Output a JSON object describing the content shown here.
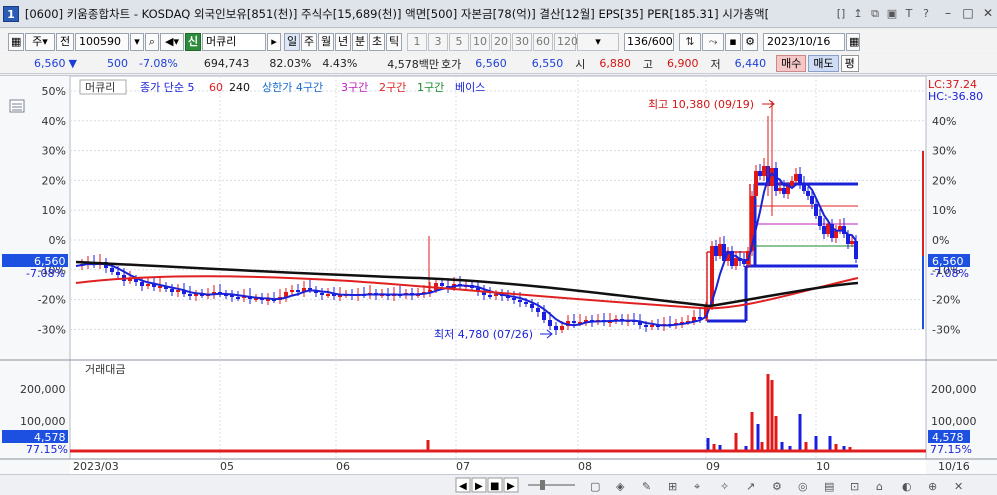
{
  "window": {
    "app_icon": "1",
    "title": "[0600] 키움종합차트 - KOSDAQ 외국인보유[851(천)] 주식수[15,689(천)] 액면[500] 자본금[78(억)] 결산[12월] EPS[35] PER[185.31] 시가총액[",
    "title_tools": [
      "[]",
      "↥",
      "⧉",
      "▣",
      "T",
      "?"
    ],
    "controls": [
      "–",
      "□",
      "✕"
    ]
  },
  "toolbar": {
    "market_select": "주",
    "prev_label": "전",
    "code": "100590",
    "stock_tag": "신",
    "stock_name": "머큐리",
    "period_buttons": [
      "일",
      "주",
      "월",
      "년",
      "분",
      "초",
      "틱"
    ],
    "interval_buttons": [
      "1",
      "3",
      "5",
      "10",
      "20",
      "30",
      "60",
      "120"
    ],
    "count": "136/600",
    "date": "2023/10/16"
  },
  "info": {
    "price": "6,560",
    "change_arrow": "▼",
    "change": "500",
    "change_pct": "-7.08%",
    "volume": "694,743",
    "vol_ratio": "82.03%",
    "turnover": "4.43%",
    "amount": "4,578백만",
    "quote_label": "호가",
    "ask": "6,560",
    "bid": "6,550",
    "open_label": "시",
    "open": "6,880",
    "high_label": "고",
    "high": "6,900",
    "low_label": "저",
    "low": "6,440",
    "buy_btn": "매수",
    "sell_btn": "매도",
    "eval_btn": "평"
  },
  "legend": {
    "name": "머큐리",
    "ma_label": "종가 단순 5",
    "ma60": "60",
    "ma240": "240",
    "sec4": "상한가 4구간",
    "sec3": "3구간",
    "sec2": "2구간",
    "sec1": "1구간",
    "base": "베이스"
  },
  "annotations": {
    "high": "최고 10,380 (09/19)",
    "low": "최저 4,780 (07/26)"
  },
  "price_panel": {
    "left_ticks": [
      "50%",
      "40%",
      "30%",
      "20%",
      "10%",
      "0%",
      "-10%",
      "-20%",
      "-30%"
    ],
    "right_ticks": [
      "40%",
      "30%",
      "20%",
      "10%",
      "0%",
      "-10%",
      "-20%",
      "-30%"
    ],
    "lc": "LC:37.24",
    "hc": "HC:-36.80",
    "price_tag": "6,560",
    "price_pct": "-7.08%"
  },
  "volume_panel": {
    "title": "거래대금",
    "ticks": [
      "200,000",
      "100,000"
    ],
    "tag": "4,578",
    "pct": "77.15%"
  },
  "x_axis": {
    "labels": [
      "2023/03",
      "05",
      "06",
      "07",
      "08",
      "09",
      "10"
    ],
    "last": "10/16"
  },
  "colors": {
    "up": "#e01818",
    "down": "#1a1ee0",
    "ma5": "#1a22d8",
    "ma60": "#e02020",
    "ma240": "#111111",
    "tag_blue": "#1d4fe0"
  },
  "icons": {
    "scroll_left": "◀",
    "play": "▶",
    "stop": "■",
    "scroll_right": "▶"
  }
}
